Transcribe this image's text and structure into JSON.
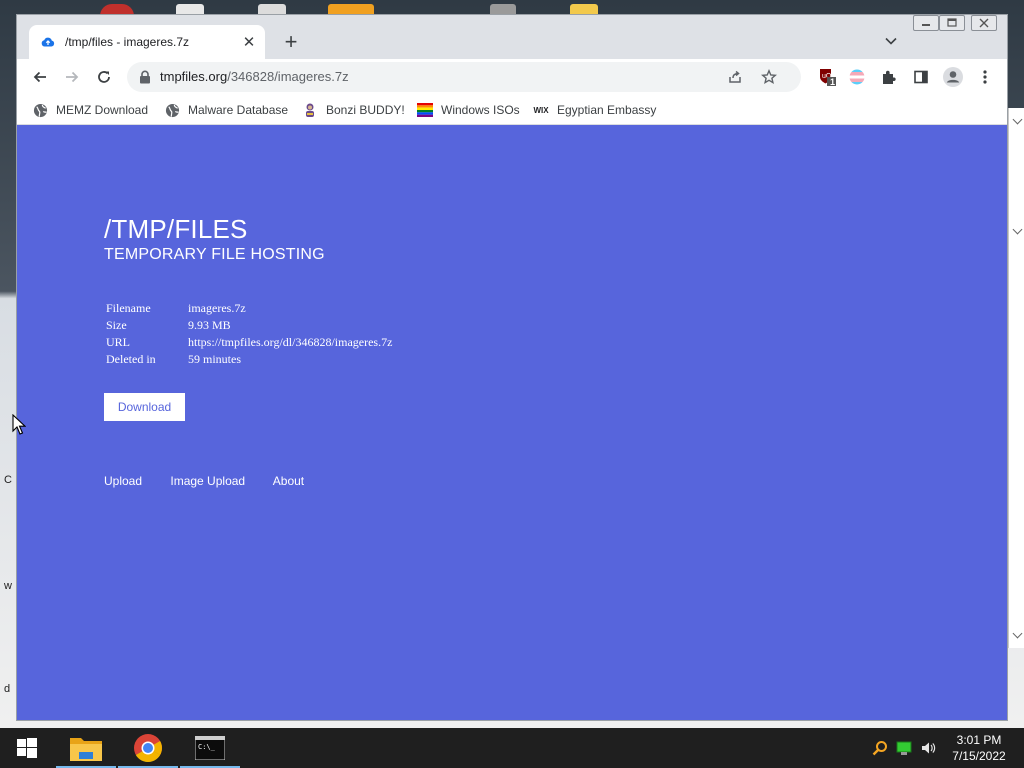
{
  "browser": {
    "tab": {
      "title": "/tmp/files - imageres.7z",
      "favicon": "cloud-upload-icon"
    },
    "new_tab_label": "+",
    "address_bar": {
      "host": "tmpfiles.org",
      "path": "/346828/imageres.7z"
    },
    "extensions": {
      "ublock_badge": "1"
    },
    "bookmarks": [
      {
        "label": "MEMZ Download",
        "icon": "globe-icon"
      },
      {
        "label": "Malware Database",
        "icon": "globe-icon"
      },
      {
        "label": "Bonzi BUDDY!",
        "icon": "bonzi-icon"
      },
      {
        "label": "Windows ISOs",
        "icon": "rainbow-flag-icon"
      },
      {
        "label": "Egyptian Embassy",
        "icon": "wix-icon"
      }
    ]
  },
  "page": {
    "title": "/TMP/FILES",
    "subtitle": "TEMPORARY FILE HOSTING",
    "file_info": [
      {
        "key": "Filename",
        "value": "imageres.7z"
      },
      {
        "key": "Size",
        "value": "9.93 MB"
      },
      {
        "key": "URL",
        "value": "https://tmpfiles.org/dl/346828/imageres.7z"
      },
      {
        "key": "Deleted in",
        "value": "59 minutes"
      }
    ],
    "download_label": "Download",
    "footer_links": [
      "Upload",
      "Image Upload",
      "About"
    ]
  },
  "desktop": {
    "edge_letters": [
      "C",
      "w",
      "d"
    ]
  },
  "taskbar": {
    "apps": [
      "file-explorer-icon",
      "chrome-icon",
      "command-prompt-icon"
    ],
    "clock_time": "3:01 PM",
    "clock_date": "7/15/2022"
  },
  "colors": {
    "page_background": "#5765dc",
    "text": "#ffffff",
    "taskbar": "#1f1f1f"
  }
}
